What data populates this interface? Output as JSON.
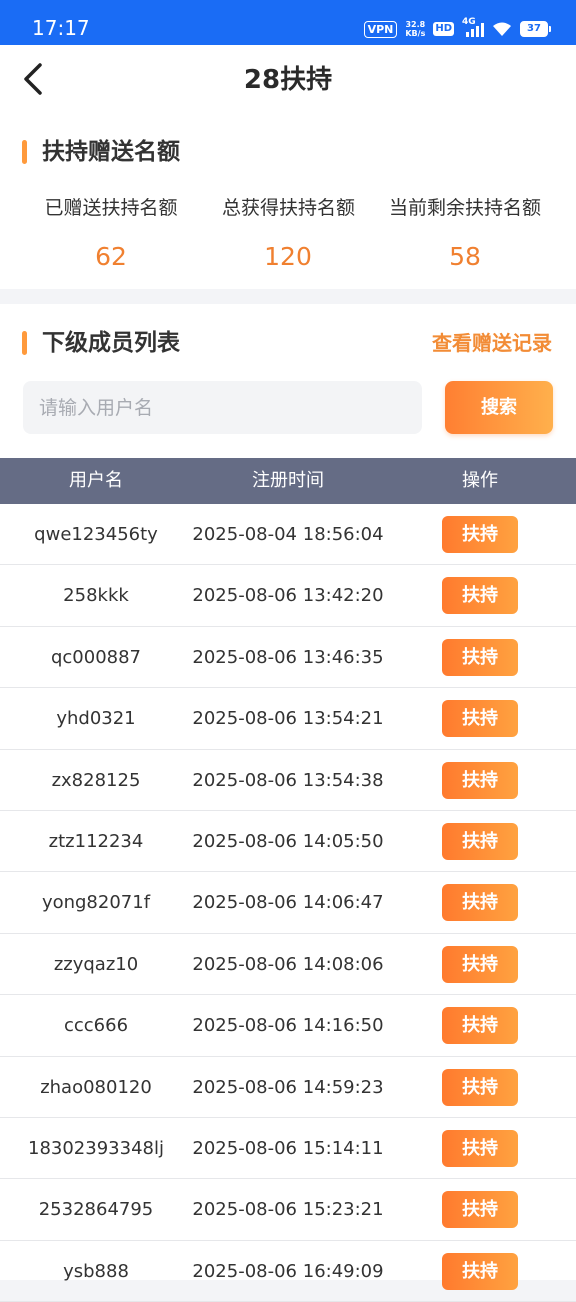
{
  "status_bar": {
    "time": "17:17",
    "vpn": "VPN",
    "speed_value": "32.8",
    "speed_unit": "KB/s",
    "hd": "HD",
    "network": "4G",
    "battery": "37"
  },
  "nav": {
    "title": "28扶持",
    "back_icon": "chevron-left-icon"
  },
  "quota": {
    "title": "扶持赠送名额",
    "stats": [
      {
        "label": "已赠送扶持名额",
        "value": "62"
      },
      {
        "label": "总获得扶持名额",
        "value": "120"
      },
      {
        "label": "当前剩余扶持名额",
        "value": "58"
      }
    ]
  },
  "members": {
    "title": "下级成员列表",
    "view_records": "查看赠送记录",
    "search_placeholder": "请输入用户名",
    "search_button": "搜索"
  },
  "table": {
    "headers": [
      "用户名",
      "注册时间",
      "操作"
    ],
    "action_label": "扶持",
    "rows": [
      {
        "username": "qwe123456ty",
        "time": "2025-08-04 18:56:04"
      },
      {
        "username": "258kkk",
        "time": "2025-08-06 13:42:20"
      },
      {
        "username": "qc000887",
        "time": "2025-08-06 13:46:35"
      },
      {
        "username": "yhd0321",
        "time": "2025-08-06 13:54:21"
      },
      {
        "username": "zx828125",
        "time": "2025-08-06 13:54:38"
      },
      {
        "username": "ztz112234",
        "time": "2025-08-06 14:05:50"
      },
      {
        "username": "yong82071f",
        "time": "2025-08-06 14:06:47"
      },
      {
        "username": "zzyqaz10",
        "time": "2025-08-06 14:08:06"
      },
      {
        "username": "ccc666",
        "time": "2025-08-06 14:16:50"
      },
      {
        "username": "zhao080120",
        "time": "2025-08-06 14:59:23"
      },
      {
        "username": "18302393348lj",
        "time": "2025-08-06 15:14:11"
      },
      {
        "username": "2532864795",
        "time": "2025-08-06 15:23:21"
      },
      {
        "username": "ysb888",
        "time": "2025-08-06 16:49:09"
      }
    ]
  },
  "colors": {
    "status_bar": "#1a6cf5",
    "accent_orange": "#f08030",
    "table_header": "#656c85"
  }
}
